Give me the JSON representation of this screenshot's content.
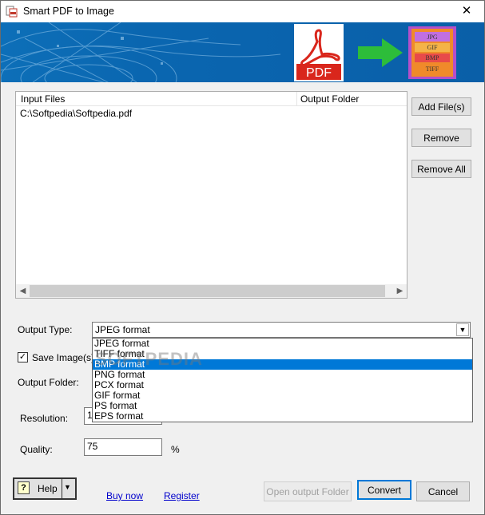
{
  "window": {
    "title": "Smart PDF to Image",
    "close_glyph": "✕"
  },
  "banner": {
    "pdf_text": "PDF",
    "formats": [
      "JPG",
      "GIF",
      "BMP",
      "TIFF"
    ]
  },
  "file_list": {
    "columns": [
      "Input Files",
      "Output Folder"
    ],
    "rows": [
      {
        "input": "C:\\Softpedia\\Softpedia.pdf",
        "output": ""
      }
    ]
  },
  "side_buttons": {
    "add": "Add File(s)",
    "remove": "Remove",
    "remove_all": "Remove All"
  },
  "output_type": {
    "label": "Output Type:",
    "value": "JPEG format",
    "options": [
      "JPEG format",
      "TIFF format",
      "BMP format",
      "PNG format",
      "PCX format",
      "GIF format",
      "PS format",
      "EPS format"
    ],
    "highlighted": "BMP format"
  },
  "save_images": {
    "label": "Save Image(s) t",
    "checked": true
  },
  "output_folder": {
    "label": "Output Folder:"
  },
  "resolution": {
    "label": "Resolution:",
    "value": "1"
  },
  "quality": {
    "label": "Quality:",
    "value": "75",
    "unit": "%"
  },
  "watermark": "SOFTPEDIA",
  "bottom": {
    "help": "Help",
    "buy_now": "Buy now",
    "register": "Register",
    "open_output_folder": "Open output Folder",
    "convert": "Convert",
    "cancel": "Cancel"
  },
  "colors": {
    "accent": "#0078d7",
    "banner": "#0a66b0",
    "link": "#0000cc"
  }
}
